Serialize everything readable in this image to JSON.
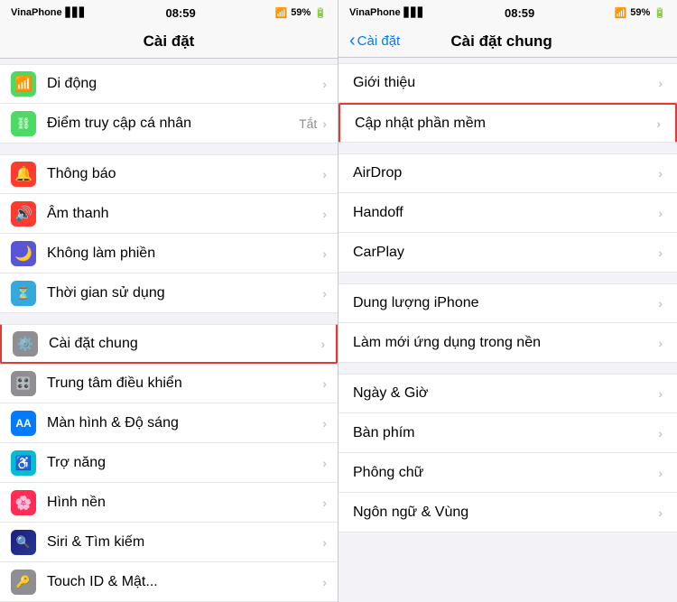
{
  "left": {
    "statusBar": {
      "carrier": "VinaPhone",
      "time": "08:59",
      "signal": "▋▋▋",
      "wifi": "WiFi",
      "battery": "59%"
    },
    "navTitle": "Cài đặt",
    "groups": [
      {
        "items": [
          {
            "icon": "📶",
            "bg": "bg-green",
            "label": "Di động",
            "value": ""
          },
          {
            "icon": "♿",
            "bg": "bg-green",
            "label": "Điểm truy cập cá nhân",
            "value": "Tắt"
          }
        ]
      },
      {
        "items": [
          {
            "icon": "🔔",
            "bg": "bg-red",
            "label": "Thông báo",
            "value": ""
          },
          {
            "icon": "🔊",
            "bg": "bg-red",
            "label": "Âm thanh",
            "value": ""
          },
          {
            "icon": "🌙",
            "bg": "bg-purple",
            "label": "Không làm phiền",
            "value": ""
          },
          {
            "icon": "⏳",
            "bg": "bg-indigo",
            "label": "Thời gian sử dụng",
            "value": ""
          }
        ]
      },
      {
        "items": [
          {
            "icon": "⚙️",
            "bg": "bg-gray",
            "label": "Cài đặt chung",
            "value": "",
            "highlight": true
          },
          {
            "icon": "🎛️",
            "bg": "bg-gray",
            "label": "Trung tâm điều khiển",
            "value": ""
          },
          {
            "icon": "Aa",
            "bg": "bg-blue",
            "label": "Màn hình & Độ sáng",
            "value": ""
          },
          {
            "icon": "♿",
            "bg": "bg-cyan",
            "label": "Trợ năng",
            "value": ""
          },
          {
            "icon": "🌸",
            "bg": "bg-pink",
            "label": "Hình nền",
            "value": ""
          },
          {
            "icon": "🔍",
            "bg": "bg-darkblue",
            "label": "Siri & Tìm kiếm",
            "value": ""
          },
          {
            "icon": "🔑",
            "bg": "bg-gray",
            "label": "Touch ID & Mật...",
            "value": ""
          }
        ]
      }
    ]
  },
  "right": {
    "statusBar": {
      "carrier": "VinaPhone",
      "time": "08:59",
      "signal": "▋▋▋",
      "wifi": "WiFi",
      "battery": "59%"
    },
    "navBack": "Cài đặt",
    "navTitle": "Cài đặt chung",
    "groups": [
      {
        "items": [
          {
            "label": "Giới thiệu",
            "highlight": false
          },
          {
            "label": "Cập nhật phần mềm",
            "highlight": true
          }
        ]
      },
      {
        "items": [
          {
            "label": "AirDrop",
            "highlight": false
          },
          {
            "label": "Handoff",
            "highlight": false
          },
          {
            "label": "CarPlay",
            "highlight": false
          }
        ]
      },
      {
        "items": [
          {
            "label": "Dung lượng iPhone",
            "highlight": false
          },
          {
            "label": "Làm mới ứng dụng trong nền",
            "highlight": false
          }
        ]
      },
      {
        "items": [
          {
            "label": "Ngày & Giờ",
            "highlight": false
          },
          {
            "label": "Bàn phím",
            "highlight": false
          },
          {
            "label": "Phông chữ",
            "highlight": false
          },
          {
            "label": "Ngôn ngữ & Vùng",
            "highlight": false
          }
        ]
      }
    ]
  },
  "icons": {
    "chevron": "›",
    "back_chevron": "‹"
  }
}
